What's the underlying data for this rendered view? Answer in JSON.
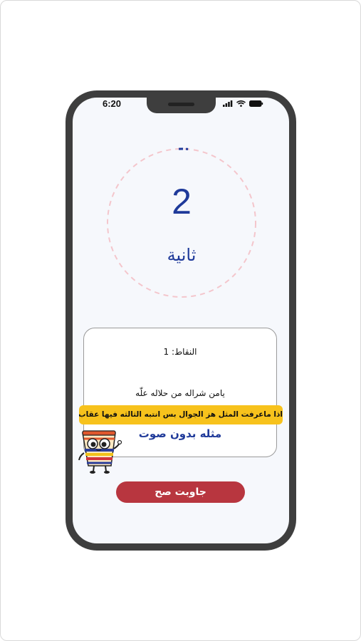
{
  "status_bar": {
    "time": "6:20"
  },
  "timer": {
    "value": "2",
    "unit": "ثانية",
    "progress_fraction": 0.02
  },
  "card": {
    "score_label": "النقاط: 1",
    "proverb_start": "يامن شراله من حلاله علّه",
    "hint": "اذا ماعرفت المثل هز الجوال بس انتبه الثالثه فيها عقاب ..",
    "mode_label": "مثله بدون صوت"
  },
  "answer_button": {
    "label": "جاوبت صح"
  },
  "colors": {
    "accent_blue": "#1f3a9a",
    "ring_pink": "#f4c6cc",
    "banner_yellow": "#f7c21c",
    "button_red": "#b8363f"
  },
  "icons": {
    "signal": "cellular-signal-icon",
    "wifi": "wifi-icon",
    "battery": "battery-icon",
    "mascot": "mascot-character-icon"
  }
}
